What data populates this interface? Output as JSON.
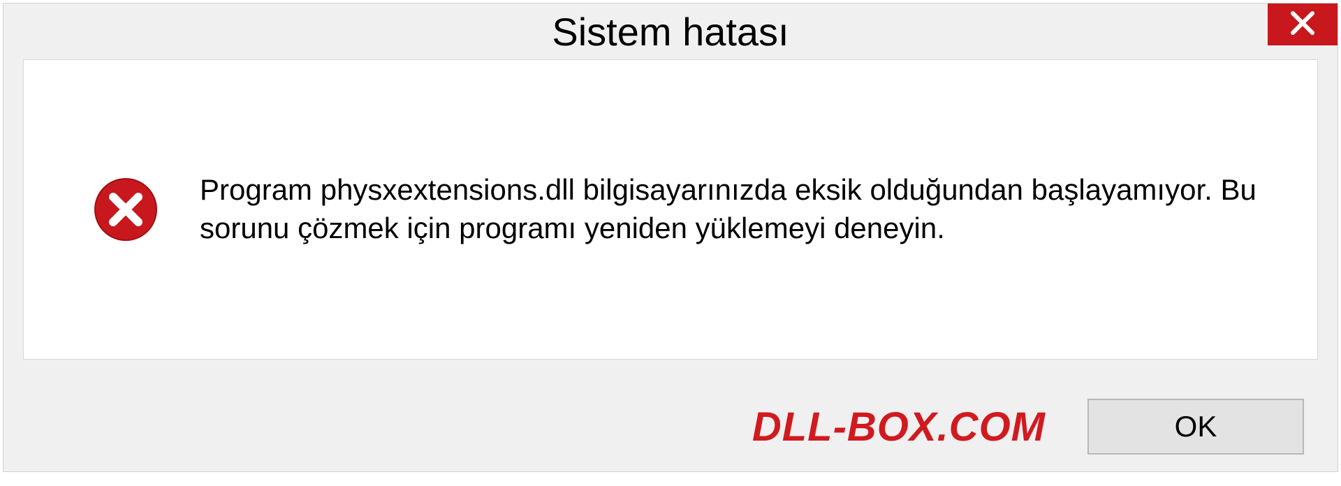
{
  "dialog": {
    "title": "Sistem hatası",
    "message": "Program physxextensions.dll bilgisayarınızda eksik olduğundan başlayamıyor. Bu sorunu çözmek için programı yeniden yüklemeyi deneyin.",
    "ok_label": "OK"
  },
  "watermark": "DLL-BOX.COM",
  "colors": {
    "close_bg": "#c8171d",
    "watermark": "#d11a1f"
  }
}
